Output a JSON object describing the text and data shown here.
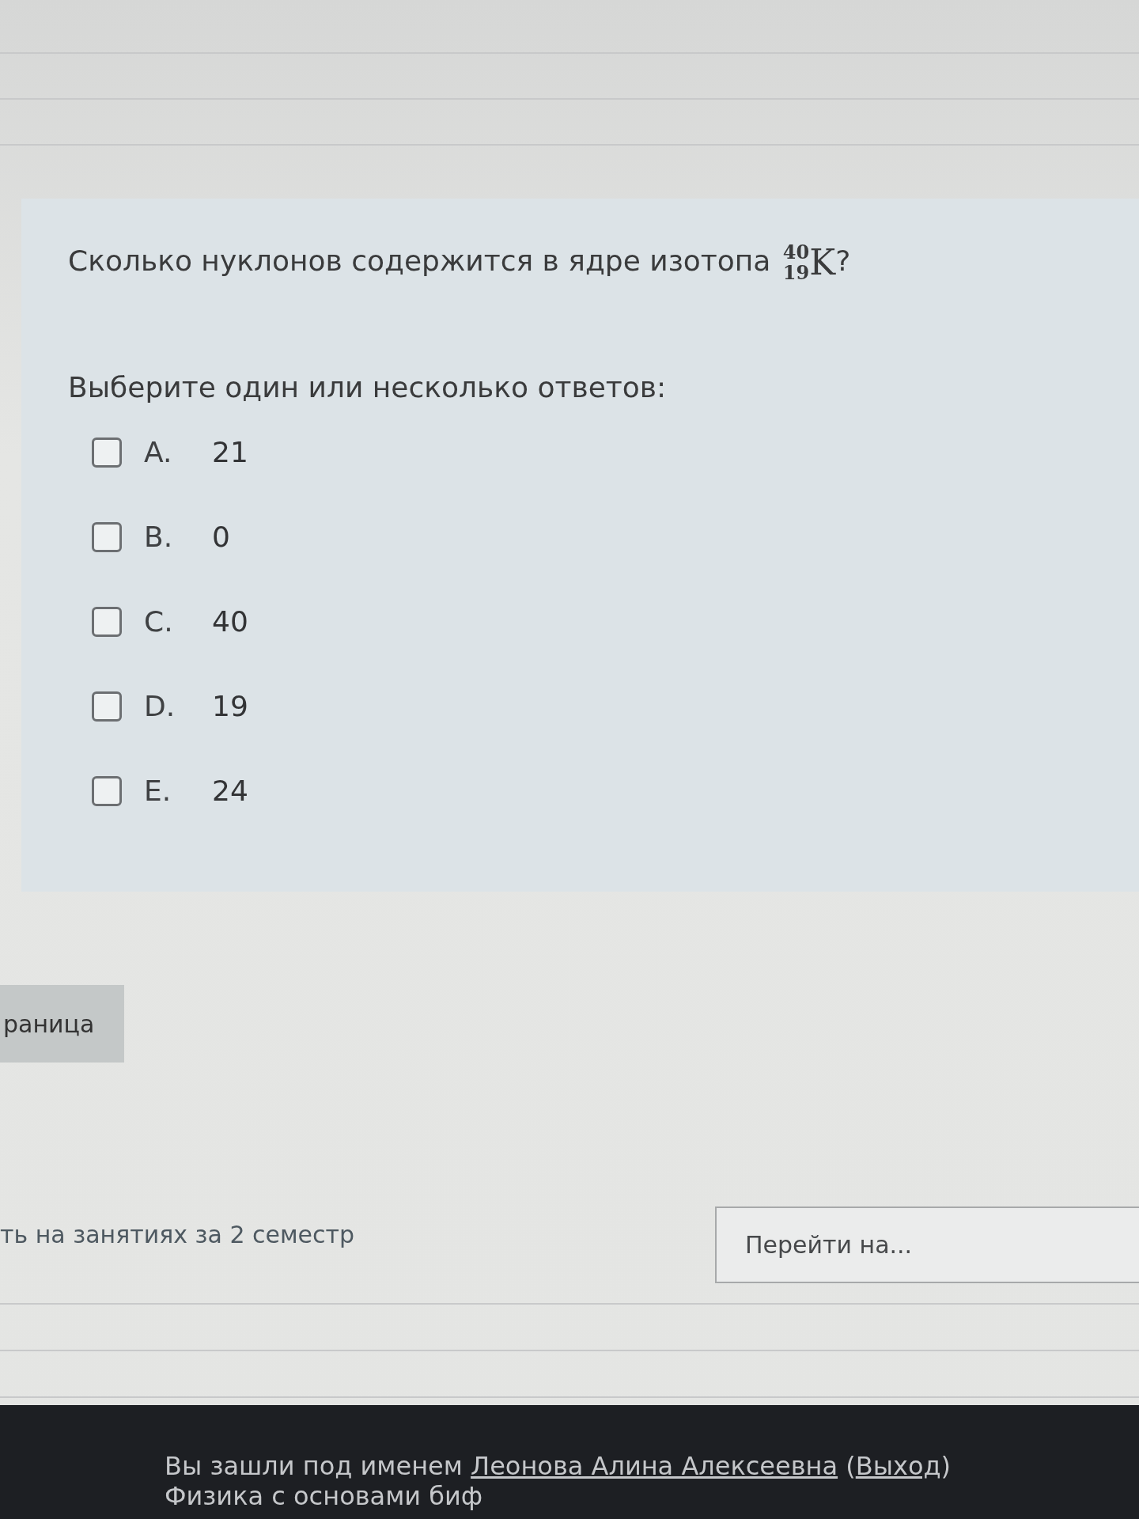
{
  "question": {
    "parts": [
      {
        "kind": "text",
        "text": "Сколько нуклонов содержится в ядре изотопа "
      },
      {
        "kind": "nuclide",
        "mass": "40",
        "atomic": "19",
        "symbol": "K"
      },
      {
        "kind": "text",
        "text": "?"
      }
    ],
    "prompt": "Выберите один или несколько ответов:",
    "options": [
      {
        "letter": "A.",
        "text": "21",
        "checked": false
      },
      {
        "letter": "B.",
        "text": "0",
        "checked": false
      },
      {
        "letter": "C.",
        "text": "40",
        "checked": false
      },
      {
        "letter": "D.",
        "text": "19",
        "checked": false
      },
      {
        "letter": "E.",
        "text": "24",
        "checked": false
      }
    ]
  },
  "navigation": {
    "next_button": "раница",
    "previous_link": "ть на занятиях за 2 семестр",
    "jump_select": {
      "value": "Перейти на..."
    }
  },
  "footer": {
    "login_parts": [
      {
        "kind": "text",
        "text": "Вы зашли под именем "
      },
      {
        "kind": "link",
        "text": "Леонова Алина Алексеевна"
      },
      {
        "kind": "text",
        "text": " ("
      },
      {
        "kind": "link",
        "text": "Выход"
      },
      {
        "kind": "text",
        "text": ")"
      }
    ],
    "course": "Физика с основами биф"
  }
}
